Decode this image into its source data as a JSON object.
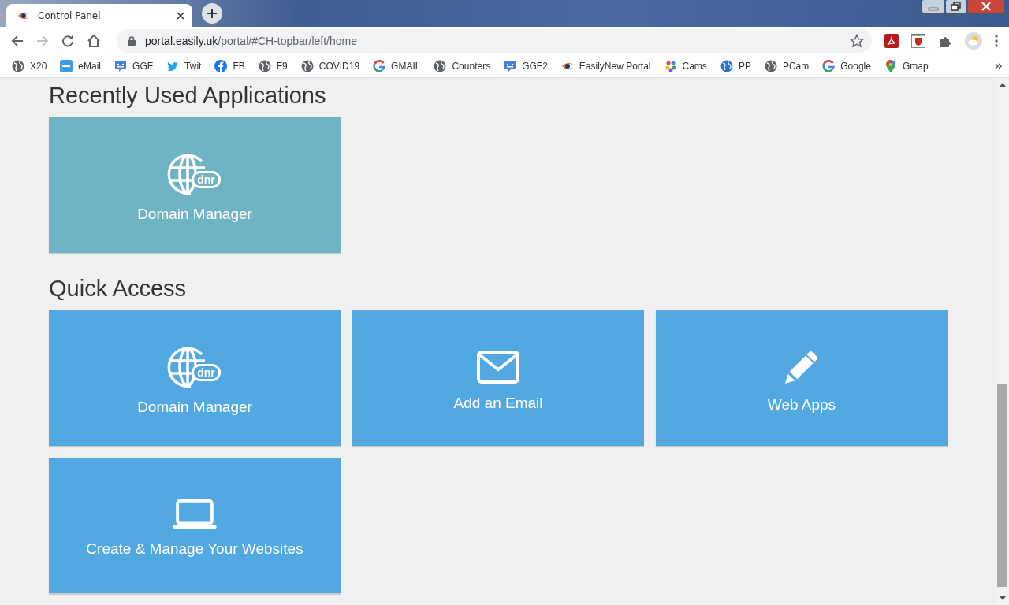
{
  "tab": {
    "title": "Control Panel"
  },
  "address_bar": {
    "domain": "portal.easily.uk",
    "path": "/portal/#CH-topbar/left/home"
  },
  "bookmarks": [
    {
      "label": "X20",
      "kind": "globe"
    },
    {
      "label": "eMail",
      "kind": "aol"
    },
    {
      "label": "GGF",
      "kind": "chat"
    },
    {
      "label": "Twit",
      "kind": "bird"
    },
    {
      "label": "FB",
      "kind": "fb"
    },
    {
      "label": "F9",
      "kind": "globe"
    },
    {
      "label": "COVID19",
      "kind": "globe"
    },
    {
      "label": "GMAIL",
      "kind": "g"
    },
    {
      "label": "Counters",
      "kind": "globe"
    },
    {
      "label": "GGF2",
      "kind": "chat"
    },
    {
      "label": "EasilyNew Portal",
      "kind": "eye"
    },
    {
      "label": "Cams",
      "kind": "dots"
    },
    {
      "label": "PP",
      "kind": "earth"
    },
    {
      "label": "PCam",
      "kind": "globe"
    },
    {
      "label": "Google",
      "kind": "g"
    },
    {
      "label": "Gmap",
      "kind": "pin"
    }
  ],
  "sections": [
    {
      "heading": "Recently Used Applications",
      "tiles": [
        {
          "label": "Domain Manager",
          "kind": "domain",
          "icon_text": "dnr"
        }
      ]
    },
    {
      "heading": "Quick Access",
      "tiles": [
        {
          "label": "Domain Manager",
          "kind": "domain",
          "icon_text": "dnr"
        },
        {
          "label": "Add an Email",
          "kind": "envelope"
        },
        {
          "label": "Web Apps",
          "kind": "pencil"
        },
        {
          "label": "Create & Manage Your Websites",
          "kind": "laptop"
        }
      ]
    }
  ]
}
